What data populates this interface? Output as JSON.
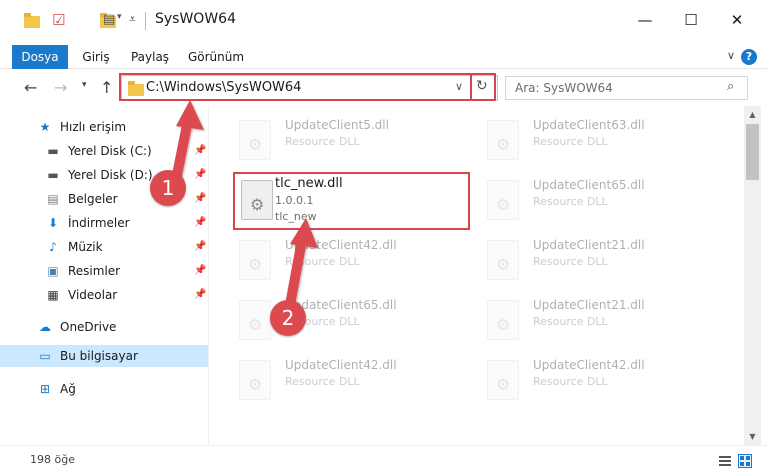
{
  "window": {
    "title": "SysWOW64",
    "minimize": "—",
    "maximize": "☐",
    "close": "✕"
  },
  "ribbon": {
    "tabs": [
      "Dosya",
      "Giriş",
      "Paylaş",
      "Görünüm"
    ],
    "active_tab": "Dosya",
    "help": "?"
  },
  "address": {
    "path": "C:\\Windows\\SysWOW64"
  },
  "search": {
    "placeholder": "Ara: SysWOW64"
  },
  "sidebar": {
    "items": [
      {
        "label": "Hızlı erişim",
        "icon": "star-icon"
      },
      {
        "label": "Yerel Disk (C:)",
        "icon": "drive-icon",
        "pinned": true
      },
      {
        "label": "Yerel Disk (D:)",
        "icon": "drive-icon",
        "pinned": true
      },
      {
        "label": "Belgeler",
        "icon": "documents-icon",
        "pinned": true
      },
      {
        "label": "İndirmeler",
        "icon": "downloads-icon",
        "pinned": true
      },
      {
        "label": "Müzik",
        "icon": "music-icon",
        "pinned": true
      },
      {
        "label": "Resimler",
        "icon": "pictures-icon",
        "pinned": true
      },
      {
        "label": "Videolar",
        "icon": "videos-icon",
        "pinned": true
      },
      {
        "label": "OneDrive",
        "icon": "cloud-icon"
      },
      {
        "label": "Bu bilgisayar",
        "icon": "computer-icon",
        "selected": true
      },
      {
        "label": "Ağ",
        "icon": "network-icon"
      }
    ]
  },
  "files": {
    "highlighted": {
      "name": "tlc_new.dll",
      "version": "1.0.0.1",
      "description": "tlc_new"
    },
    "items": [
      {
        "name": "UpdateClient5.dll",
        "description": "Resource DLL"
      },
      {
        "name": "UpdateClient63.dll",
        "description": "Resource DLL"
      },
      {
        "name": "UpdateClient65.dll",
        "description": "Resource DLL"
      },
      {
        "name": "UpdateClient42.dll",
        "description": "Resource DLL"
      },
      {
        "name": "UpdateClient21.dll",
        "description": "Resource DLL"
      },
      {
        "name": "UpdateClient65.dll",
        "description": "Resource DLL"
      },
      {
        "name": "UpdateClient21.dll",
        "description": "Resource DLL"
      },
      {
        "name": "UpdateClient42.dll",
        "description": "Resource DLL"
      },
      {
        "name": "UpdateClient42.dll",
        "description": "Resource DLL"
      }
    ]
  },
  "status": {
    "count": "198 öğe"
  },
  "annotations": {
    "step1": "1",
    "step2": "2",
    "color": "#dc4a4f"
  }
}
